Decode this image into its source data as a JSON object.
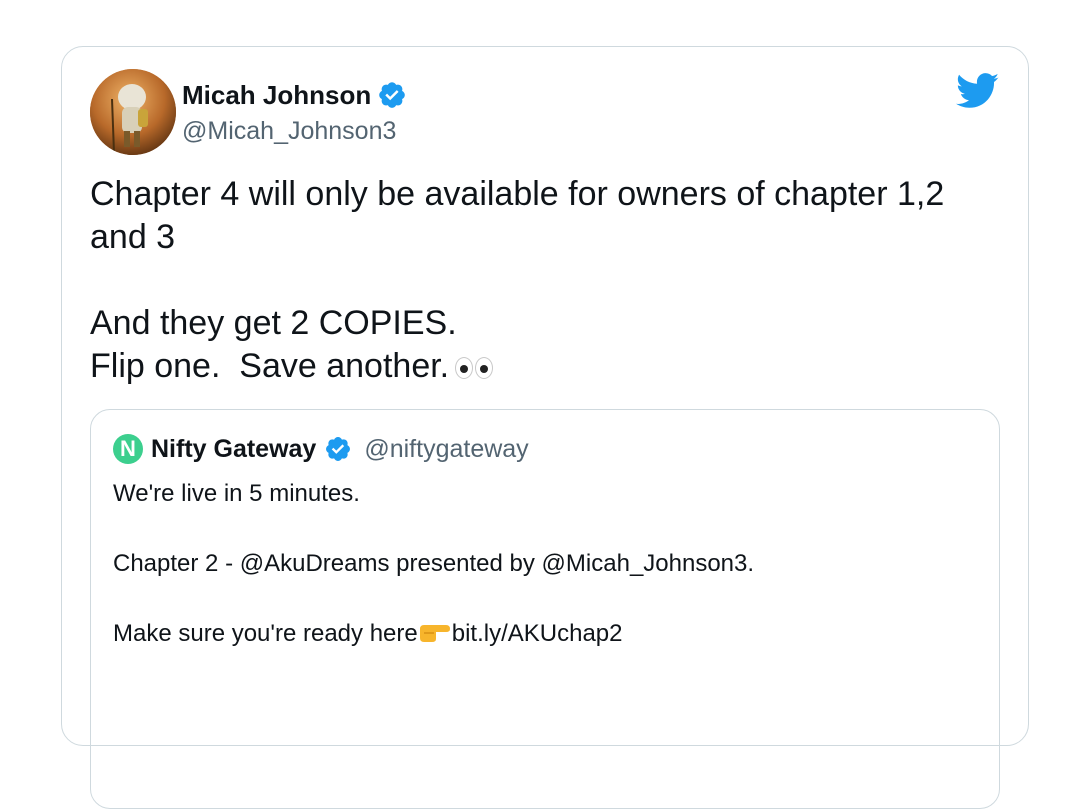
{
  "author": {
    "name": "Micah Johnson",
    "handle": "@Micah_Johnson3",
    "verified": true,
    "avatar_icon": "avatar-astronaut-character"
  },
  "brand": {
    "icon": "twitter-bird-icon",
    "color": "#1d9bf0"
  },
  "tweet": {
    "line1": "Chapter 4 will only be available for owners of chapter 1,2 and 3",
    "line2": "And they get 2 COPIES.",
    "line3": "Flip one.  Save another.",
    "emoji": "eyes"
  },
  "quoted_tweet": {
    "avatar_letter": "N",
    "avatar_color": "#3ccf8e",
    "name": "Nifty Gateway",
    "handle": "@niftygateway",
    "verified": true,
    "line1": "We're live in 5 minutes.",
    "line2": "Chapter 2 - @AkuDreams presented by @Micah_Johnson3.",
    "line3_prefix": "Make sure you're ready here",
    "line3_emoji": "pointing-right-hand",
    "line3_link": "bit.ly/AKUchap2"
  },
  "colors": {
    "verified_blue": "#1d9bf0",
    "secondary_text": "#536471",
    "border": "#cfd9de"
  }
}
